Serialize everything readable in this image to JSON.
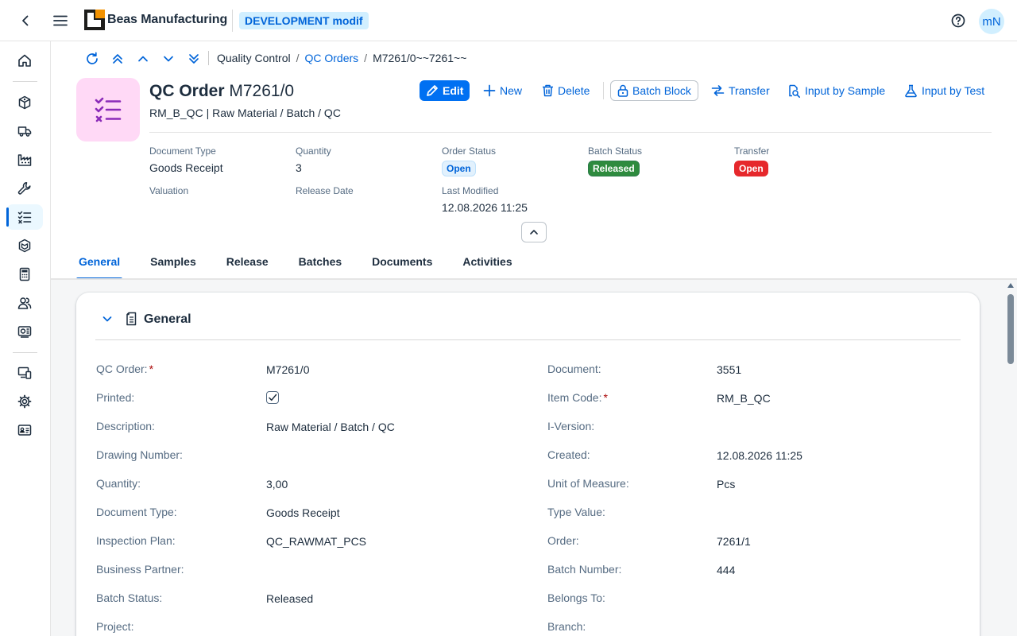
{
  "shell": {
    "app_title": "Beas Manufacturing",
    "environment": "DEVELOPMENT modif",
    "user_initials": "mN"
  },
  "breadcrumb": {
    "root": "Quality Control",
    "sep1": "/",
    "parent": "QC Orders",
    "sep2": "/",
    "current": "M7261/0~~7261~~"
  },
  "header": {
    "title_type": "QC Order",
    "title_id": "M7261/0",
    "subtitle": "RM_B_QC | Raw Material / Batch / QC",
    "actions": {
      "edit": "Edit",
      "new": "New",
      "delete": "Delete",
      "batch_block": "Batch Block",
      "transfer": "Transfer",
      "input_by_sample": "Input by Sample",
      "input_by_test": "Input by Test"
    },
    "attributes": {
      "document_type_label": "Document Type",
      "document_type": "Goods Receipt",
      "quantity_label": "Quantity",
      "quantity": "3",
      "order_status_label": "Order Status",
      "order_status": "Open",
      "batch_status_label": "Batch Status",
      "batch_status": "Released",
      "transfer_label": "Transfer",
      "transfer": "Open",
      "valuation_label": "Valuation",
      "release_date_label": "Release Date",
      "last_modified_label": "Last Modified",
      "last_modified": "12.08.2026 11:25"
    }
  },
  "tabs": [
    "General",
    "Samples",
    "Release",
    "Batches",
    "Documents",
    "Activities"
  ],
  "section": {
    "title": "General",
    "left_fields": [
      {
        "label": "QC Order:",
        "value": "M7261/0",
        "required": "*"
      },
      {
        "label": "Printed:",
        "value": ""
      },
      {
        "label": "Description:",
        "value": "Raw Material / Batch / QC"
      },
      {
        "label": "Drawing Number:",
        "value": ""
      },
      {
        "label": "Quantity:",
        "value": "3,00"
      },
      {
        "label": "Document Type:",
        "value": "Goods Receipt"
      },
      {
        "label": "Inspection Plan:",
        "value": "QC_RAWMAT_PCS"
      },
      {
        "label": "Business Partner:",
        "value": ""
      },
      {
        "label": "Batch Status:",
        "value": "Released"
      },
      {
        "label": "Project:",
        "value": ""
      }
    ],
    "right_fields": [
      {
        "label": "Document:",
        "value": "3551"
      },
      {
        "label": "Item Code:",
        "value": "RM_B_QC",
        "required": "*"
      },
      {
        "label": "I-Version:",
        "value": ""
      },
      {
        "label": "Created:",
        "value": "12.08.2026 11:25"
      },
      {
        "label": "Unit of Measure:",
        "value": "Pcs"
      },
      {
        "label": "Type Value:",
        "value": ""
      },
      {
        "label": "Order:",
        "value": "7261/1"
      },
      {
        "label": "Batch Number:",
        "value": "444"
      },
      {
        "label": "Belongs To:",
        "value": ""
      },
      {
        "label": "Branch:",
        "value": ""
      }
    ]
  },
  "colors": {
    "brand": "#0064d9",
    "primary_button": "#0070f2",
    "success": "#2e8b3e",
    "error": "#e6282c",
    "object_icon_bg": "#ffd9f6",
    "object_icon_fg": "#8b2bb8"
  }
}
